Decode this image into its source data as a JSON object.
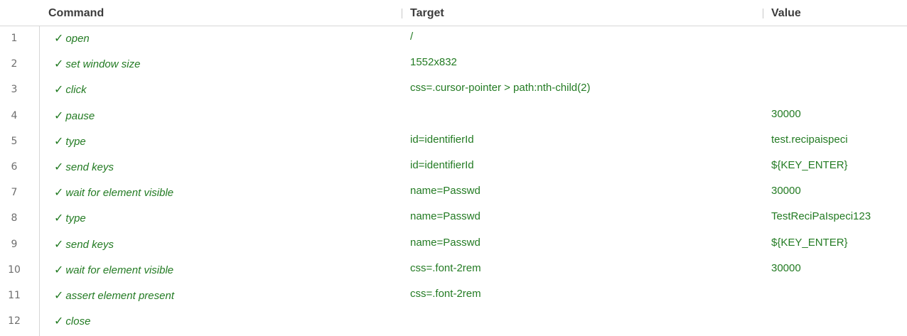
{
  "header": {
    "command": "Command",
    "target": "Target",
    "value": "Value"
  },
  "check_glyph": "✓",
  "accent_color": "#237b23",
  "rows": [
    {
      "num": "1",
      "command": "open",
      "target": "/",
      "value": ""
    },
    {
      "num": "2",
      "command": "set window size",
      "target": "1552x832",
      "value": ""
    },
    {
      "num": "3",
      "command": "click",
      "target": "css=.cursor-pointer > path:nth-child(2)",
      "value": ""
    },
    {
      "num": "4",
      "command": "pause",
      "target": "",
      "value": "30000"
    },
    {
      "num": "5",
      "command": "type",
      "target": "id=identifierId",
      "value": "test.recipaispeci"
    },
    {
      "num": "6",
      "command": "send keys",
      "target": "id=identifierId",
      "value": "${KEY_ENTER}"
    },
    {
      "num": "7",
      "command": "wait for element visible",
      "target": "name=Passwd",
      "value": "30000"
    },
    {
      "num": "8",
      "command": "type",
      "target": "name=Passwd",
      "value": "TestReciPaIspeci123"
    },
    {
      "num": "9",
      "command": "send keys",
      "target": "name=Passwd",
      "value": "${KEY_ENTER}"
    },
    {
      "num": "10",
      "command": "wait for element visible",
      "target": "css=.font-2rem",
      "value": "30000"
    },
    {
      "num": "11",
      "command": "assert element present",
      "target": "css=.font-2rem",
      "value": ""
    },
    {
      "num": "12",
      "command": "close",
      "target": "",
      "value": ""
    }
  ]
}
